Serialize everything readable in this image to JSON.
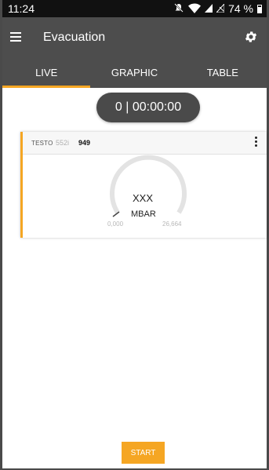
{
  "status_bar": {
    "time": "11:24",
    "battery_percent": "74 %",
    "icons": [
      "mute-icon",
      "wifi-icon",
      "signal-icon",
      "no-signal-icon",
      "battery-icon"
    ]
  },
  "app_bar": {
    "title": "Evacuation",
    "menu_icon": "hamburger-menu-icon",
    "settings_icon": "gear-icon"
  },
  "tabs": [
    {
      "label": "LIVE",
      "active": true
    },
    {
      "label": "GRAPHIC",
      "active": false
    },
    {
      "label": "TABLE",
      "active": false
    }
  ],
  "timer": "0 | 00:00:00",
  "sensor_card": {
    "brand": "TESTO",
    "model": "552i",
    "serial": "949",
    "reading": "XXX",
    "unit": "MBAR",
    "gauge_min": "0,000",
    "gauge_max": "26,664",
    "accent_color": "#f5a623"
  },
  "start_button": {
    "label": "START"
  },
  "colors": {
    "accent": "#f5a623",
    "appbar": "#4d4d4d",
    "statusbar": "#111111"
  }
}
